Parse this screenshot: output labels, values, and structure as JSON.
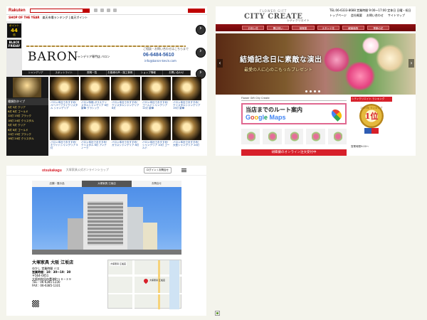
{
  "p1": {
    "logo": "Rakuten",
    "shop_of_year": "SHOP OF THE YEAR",
    "nav_text": "楽天市場ランキング | 楽天ポイント",
    "promo1_top": "ポイント",
    "promo1_num": "44",
    "promo1_unit": "倍",
    "promo2_top": "BLACK FRIDAY",
    "promo3_top": "ポイント",
    "promo3_num": "44",
    "promo3_unit": "倍",
    "brand": "BARON",
    "brand_sub": "シャンデリア専門店 バロン",
    "tel_note": "ご相談・お問い合わせはこちらまで",
    "tel": "06-6484-5610",
    "mail": "info@baron-kevin.com",
    "menu": [
      "シャンデリア",
      "スポットライト",
      "照明一覧",
      "お客様の声・施工事例",
      "ショップ情報",
      "お問い合わせ"
    ],
    "category_title": "種類別タイプ",
    "category_items": [
      "3灯 5灯 クリア",
      "6灯 8灯 ゴールド",
      "12灯 15灯 ブラック",
      "18灯 24灯 クリスタル",
      "3灯 5灯 クリア",
      "6灯 8灯 ゴールド",
      "12灯 15灯 ブラック",
      "18灯 24灯 クリスタル"
    ],
    "products": [
      "バロン本社でおすすめ！ペーパーフライクリスタル シャンデリア",
      "バロン特価 ガラスクリスタルシャンデリア 6灯 豪華 クラシック",
      "バロン本社でおすすめ！クリスタルシャンデリア 8灯",
      "バロン本社でおすすめ！ゴールドシャンデリア 12灯 豪華",
      "バロン本社でおすすめ！クリスタルシャンデリア 15灯 豪華",
      "バロン本社でおすすめ！ホワイトシャンデリア 5灯",
      "バロン本社でおすすめ！クリスタル 6灯 アンティーク",
      "バロン本社でおすすめ！ガラスシャンデリア 8灯",
      "バロン本社でおすすめ！シャンデリア 10灯 ゴールド",
      "バロン本社でおすすめ！大型シャンデリア 24灯"
    ]
  },
  "p2": {
    "brand_small": "FLOWER GIFT",
    "brand_big": "CITY CREATE",
    "brand_jp": "シティクリエイト",
    "contact_tel": "TEL:06-6333-8688 営業時間 9:00〜17:00 定休日 日曜・祝日",
    "contact_links": [
      "トップページ",
      "会社概要",
      "お問い合わせ",
      "サイトマップ"
    ],
    "nav": [
      "お祝い花",
      "開店祝い",
      "胡蝶蘭",
      "スタンド花",
      "観葉植物",
      "季節の花"
    ],
    "hero_title": "結婚記念日に素敵な演出",
    "hero_sub": "最愛の人に心のこもったプレゼント",
    "section_title": "Flower Gift City Create",
    "map_line1": "当店までのルート案内",
    "map_line2_g": "G",
    "map_line2_o1": "o",
    "map_line2_o2": "o",
    "map_line2_gl": "gl",
    "map_line2_e": "e",
    "map_line2_rest": " Maps",
    "order_bar": "胡蝶蘭のオンライン注文受付中",
    "side_header": "シティクリエイト ランキング",
    "medal_small": "2023年 ランキング",
    "medal_num": "1位",
    "mascot_text": "営業時間9:00〜"
  },
  "p3": {
    "logo": "otsukakagu",
    "tagline": "大塚家具公式オンラインショップ",
    "login": "ログイン / お問合せ",
    "tabs": [
      "店舗・展示品",
      "大塚家具 江坂店",
      "お問合せ"
    ],
    "store_name": "大塚家具 大阪 江坂店",
    "hours_label": "ゆかし 営業時間 バス",
    "hours": "営業時間：10：30～19：30",
    "postal": "〒564-0051",
    "address": "大阪府吹田市豊津町１０−３９",
    "tel": "TEL：06-6385-1330",
    "fax": "FAX：06-6385-1331",
    "map_label": "大塚家具 江坂店",
    "map_pin_label": "大塚家具 江坂店"
  }
}
